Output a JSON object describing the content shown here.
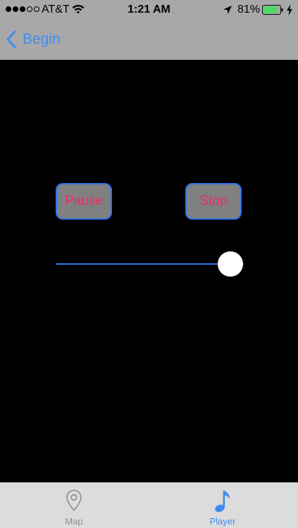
{
  "status_bar": {
    "signal_bars_filled": 3,
    "signal_bars_total": 5,
    "carrier": "AT&T",
    "time": "1:21 AM",
    "battery_percent": "81%",
    "battery_level": 0.81,
    "icons": [
      "wifi-icon",
      "location-arrow-icon",
      "battery-icon",
      "charging-bolt-icon"
    ]
  },
  "nav": {
    "back_label": "Begin",
    "back_icon": "chevron-left-icon"
  },
  "controls": {
    "pause_label": "Pause",
    "stop_label": "Stop"
  },
  "slider": {
    "value": 0.93
  },
  "tabs": [
    {
      "label": "Map",
      "icon": "map-pin-icon",
      "selected": false
    },
    {
      "label": "Player",
      "icon": "music-note-icon",
      "selected": true
    }
  ],
  "colors": {
    "header_bg": "#a8a8a8",
    "accent_blue": "#3d8ef0",
    "button_border": "#2f72ee",
    "button_text": "#ec2e66",
    "button_bg": "#808080",
    "content_bg": "#000000",
    "tab_bar_bg": "#dcdcdc"
  }
}
